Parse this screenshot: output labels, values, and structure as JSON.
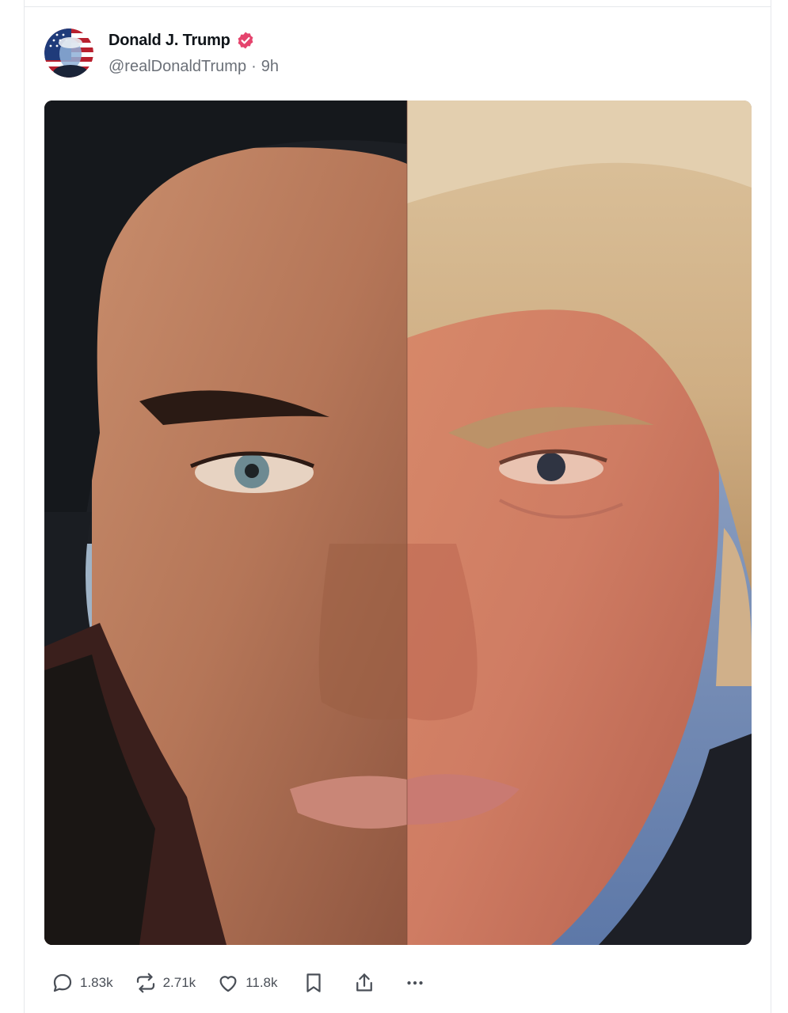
{
  "post": {
    "author": {
      "display_name": "Donald J. Trump",
      "handle": "@realDonaldTrump",
      "timestamp": "9h",
      "verified_badge": "check-badge-icon",
      "verified_color": "#e5446d"
    },
    "media": {
      "type": "photo",
      "left_hair_color": "#15181c",
      "right_hair_color": "#d4b891"
    },
    "actions": {
      "reply": {
        "icon": "reply-icon",
        "count": "1.83k"
      },
      "repost": {
        "icon": "repost-icon",
        "count": "2.71k"
      },
      "like": {
        "icon": "heart-icon",
        "count": "11.8k"
      },
      "bookmark": {
        "icon": "bookmark-icon"
      },
      "share": {
        "icon": "share-icon"
      },
      "more": {
        "icon": "more-icon"
      }
    }
  }
}
